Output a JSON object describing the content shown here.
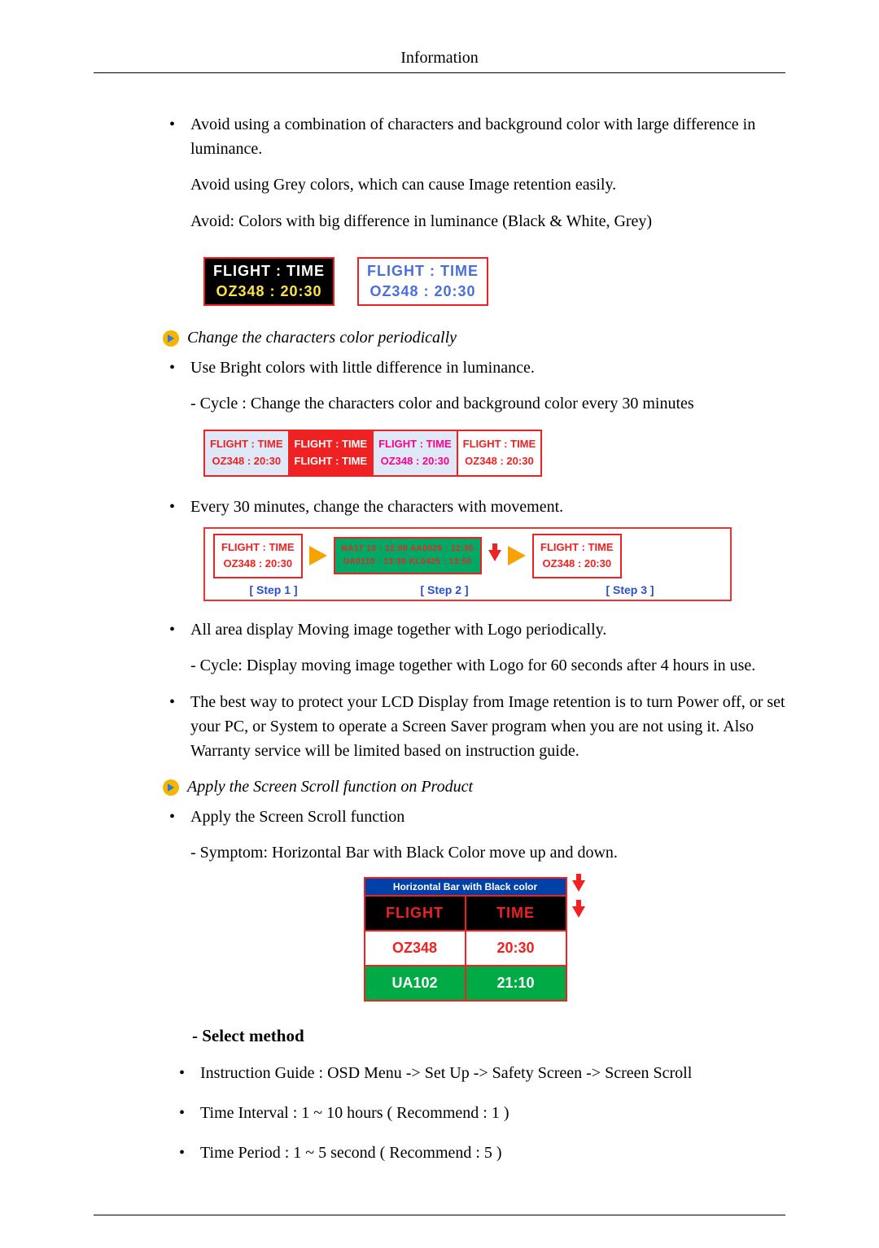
{
  "header": {
    "title": "Information"
  },
  "s1": {
    "bullet1": "Avoid using a combination of characters and background color with large difference in luminance.",
    "p1": "Avoid using Grey colors, which can cause Image retention easily.",
    "p2": "Avoid: Colors with big difference in luminance (Black & White, Grey)"
  },
  "fig1": {
    "a_l1": "FLIGHT  :  TIME",
    "a_l2": "OZ348    :  20:30",
    "b_l1": "FLIGHT  :  TIME",
    "b_l2": "OZ348    :  20:30"
  },
  "sec2": {
    "title": "Change the characters color periodically"
  },
  "s2": {
    "bullet1": "Use Bright colors with little difference in luminance.",
    "sub1": "- Cycle : Change the characters color and background color every 30 minutes"
  },
  "fig2": {
    "c1t1": "FLIGHT : TIME",
    "c1t2": "OZ348   : 20:30",
    "c2t1": "FLIGHT : TIME",
    "c2t2": "FLIGHT : TIME",
    "c3t1": "FLIGHT  :  TIME",
    "c3t2": "OZ348   : 20:30",
    "c4t1": "FLIGHT : TIME",
    "c4t2": "OZ348   : 20:30"
  },
  "s3": {
    "bullet1": "Every 30 minutes, change the characters with movement."
  },
  "fig3": {
    "b1t1": "FLIGHT : TIME",
    "b1t2": "OZ348   : 20:30",
    "b2t1": "NA17 10 : 12:00  AA0025 : 12:35",
    "b2t2": "UA0110 : 13:30  KL0425 : 13:50",
    "b3t1": "FLIGHT : TIME",
    "b3t2": "OZ348   : 20:30",
    "step1": "[ Step 1 ]",
    "step2": "[ Step 2 ]",
    "step3": "[ Step 3 ]"
  },
  "s4": {
    "bullet1": "All area display Moving image together with Logo periodically.",
    "sub1": "- Cycle: Display moving image together with Logo for 60 seconds after 4 hours in use.",
    "bullet2": "The best way to protect your LCD Display from Image retention is to turn Power off, or set your PC, or System to operate a Screen Saver program when you are not using it. Also Warranty service will be limited based on instruction guide."
  },
  "sec3": {
    "title": "Apply the Screen Scroll function on Product"
  },
  "s5": {
    "bullet1": "Apply the Screen Scroll function",
    "sub1": "- Symptom: Horizontal Bar with Black Color move up and down."
  },
  "fig4": {
    "caption": "Horizontal Bar with Black color",
    "h1": "FLIGHT",
    "h2": "TIME",
    "r1a": "OZ348",
    "r1b": "20:30",
    "r2a": "UA102",
    "r2b": "21:10"
  },
  "method": {
    "heading": "- Select method",
    "b1": "Instruction Guide : OSD Menu -> Set Up -> Safety Screen -> Screen Scroll",
    "b2": "Time Interval : 1 ~ 10 hours ( Recommend : 1 )",
    "b3": "Time Period : 1 ~ 5 second ( Recommend : 5 )"
  }
}
